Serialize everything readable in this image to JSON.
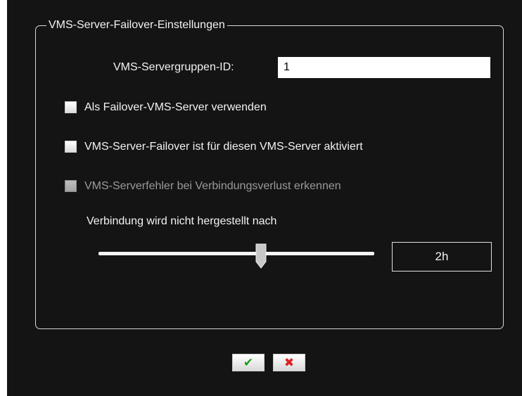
{
  "group": {
    "title": "VMS-Server-Failover-Einstellungen"
  },
  "server_group": {
    "label": "VMS-Servergruppen-ID:",
    "value": "1"
  },
  "checkboxes": [
    {
      "label": "Als Failover-VMS-Server verwenden",
      "checked": false,
      "enabled": true
    },
    {
      "label": "VMS-Server-Failover ist für diesen VMS-Server aktiviert",
      "checked": false,
      "enabled": true
    },
    {
      "label": "VMS-Serverfehler bei Verbindungsverlust erkennen",
      "checked": false,
      "enabled": false
    }
  ],
  "timeout": {
    "label": "Verbindung wird nicht hergestellt nach",
    "slider_level": 0.59,
    "value": "2h"
  },
  "buttons": {
    "ok_icon": "checkmark-icon",
    "cancel_icon": "x-icon",
    "ok_glyph": "✔",
    "cancel_glyph": "✖",
    "ok_color": "#1e9e1e",
    "cancel_color": "#e02020"
  },
  "colors": {
    "background": "#141414",
    "text": "#f2f2f2",
    "disabled_text": "#9a9a9a"
  }
}
